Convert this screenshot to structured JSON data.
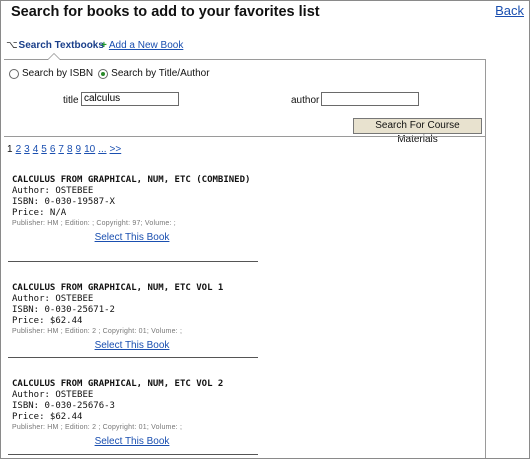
{
  "page": {
    "title": "Search for books to add to your favorites list",
    "back_label": "Back"
  },
  "tabs": {
    "search_textbooks": "Search Textbooks",
    "add_new_book": "Add a New Book"
  },
  "search": {
    "radio_isbn": "Search by ISBN",
    "radio_title_author": "Search by Title/Author",
    "selected_mode": "Search by Title/Author",
    "title_label": "title",
    "title_value": "calculus",
    "author_label": "author",
    "author_value": "",
    "submit_label": "Search For Course Materials"
  },
  "pagination": {
    "current": "1",
    "pages": [
      "2",
      "3",
      "4",
      "5",
      "6",
      "7",
      "8",
      "9",
      "10"
    ],
    "more": "...",
    "next": ">>"
  },
  "results": [
    {
      "title": "CALCULUS FROM GRAPHICAL, NUM, ETC (COMBINED)",
      "author": "Author: OSTEBEE",
      "isbn": "ISBN: 0-030-19587-X",
      "price": "Price: N/A",
      "meta": "Publisher: HM ; Edition: ; Copyright: 97; Volume: ;",
      "select_label": "Select This Book"
    },
    {
      "title": "CALCULUS FROM GRAPHICAL, NUM, ETC VOL 1",
      "author": "Author: OSTEBEE",
      "isbn": "ISBN: 0-030-25671-2",
      "price": "Price: $62.44",
      "meta": "Publisher: HM ; Edition: 2 ; Copyright: 01; Volume: ;",
      "select_label": "Select This Book"
    },
    {
      "title": "CALCULUS FROM GRAPHICAL, NUM, ETC VOL 2",
      "author": "Author: OSTEBEE",
      "isbn": "ISBN: 0-030-25676-3",
      "price": "Price: $62.44",
      "meta": "Publisher: HM ; Edition: 2 ; Copyright: 01; Volume: ;",
      "select_label": "Select This Book"
    }
  ],
  "icons": {
    "search_tab": "key-icon",
    "add_tab": "plus-icon"
  },
  "colors": {
    "link": "#1a4fb0",
    "button_bg": "#e8e2cf",
    "plus_icon": "#1f9a2a"
  }
}
